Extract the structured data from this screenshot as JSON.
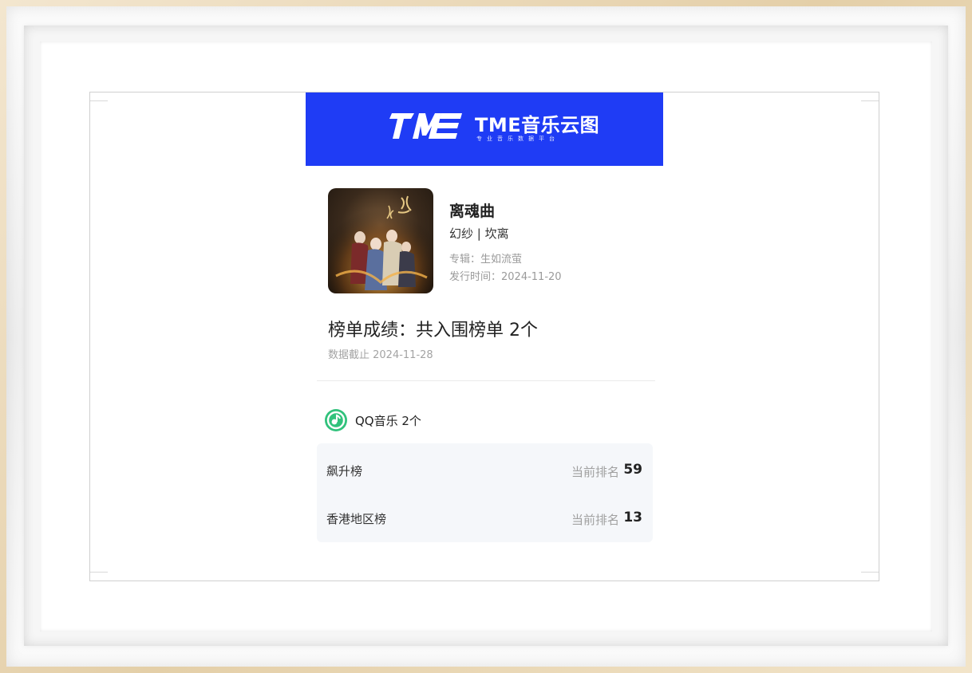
{
  "header": {
    "brand_name": "TME音乐云图",
    "brand_subtitle": "专业音乐数据平台",
    "logo_icon": "tme-logo-icon",
    "background_color": "#1f3cf5"
  },
  "song": {
    "title": "离魂曲",
    "artist": "幻纱 | 坎离",
    "album": "专辑：生如流萤",
    "release": "发行时间：2024-11-20",
    "cover_icon": "album-cover-image"
  },
  "summary": {
    "chart_result": "榜单成绩：共入围榜单 2个",
    "data_as_of": "数据截止 2024-11-28"
  },
  "platform": {
    "label": "QQ音乐 2个",
    "icon": "qq-music-icon",
    "accent_color": "#31c27c"
  },
  "ranks": [
    {
      "chart": "飙升榜",
      "label": "当前排名",
      "value": "59"
    },
    {
      "chart": "香港地区榜",
      "label": "当前排名",
      "value": "13"
    }
  ]
}
